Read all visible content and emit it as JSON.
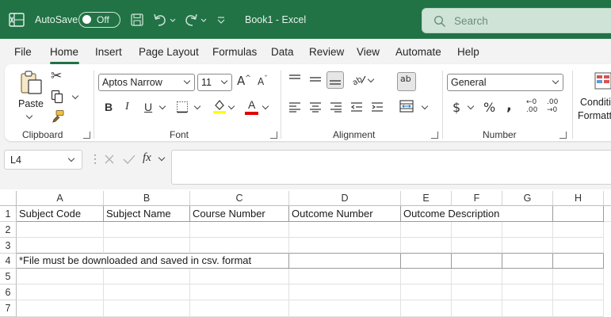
{
  "titlebar": {
    "autosave_label": "AutoSave",
    "autosave_state": "Off",
    "document_title": "Book1  -  Excel",
    "search_placeholder": "Search",
    "accent_color": "#217346"
  },
  "menu": {
    "tabs": [
      "File",
      "Home",
      "Insert",
      "Page Layout",
      "Formulas",
      "Data",
      "Review",
      "View",
      "Automate",
      "Help"
    ],
    "active_tab": "Home"
  },
  "ribbon": {
    "clipboard": {
      "label": "Clipboard",
      "paste_label": "Paste"
    },
    "font": {
      "label": "Font",
      "font_name": "Aptos Narrow",
      "font_size": "11"
    },
    "alignment": {
      "label": "Alignment"
    },
    "number": {
      "label": "Number",
      "format": "General"
    },
    "styles": {
      "conditional_label_1": "Conditi",
      "conditional_label_2": "Formatt"
    }
  },
  "formula_bar": {
    "name_box": "L4",
    "formula": ""
  },
  "sheet": {
    "columns": [
      "A",
      "B",
      "C",
      "D",
      "E",
      "F",
      "G",
      "H"
    ],
    "rows": [
      "1",
      "2",
      "3",
      "4",
      "5",
      "6",
      "7"
    ],
    "headers": {
      "a1": "Subject Code",
      "b1": "Subject Name",
      "c1": "Course Number",
      "d1": "Outcome Number",
      "e1": "Outcome Description"
    },
    "note_a4": "*File must be downloaded and saved in csv. format"
  }
}
